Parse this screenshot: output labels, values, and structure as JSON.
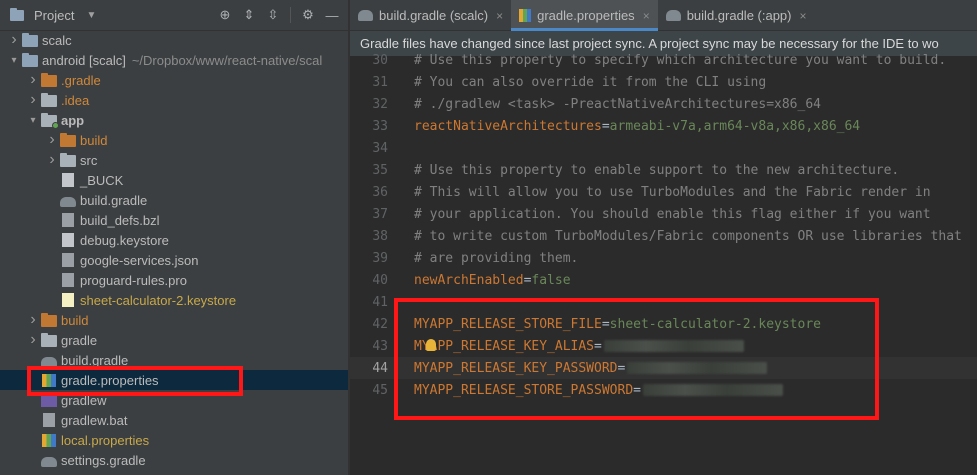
{
  "project_panel": {
    "title": "Project",
    "tree": [
      {
        "label": "scalc",
        "type": "folder-blue",
        "arrow": "right",
        "indent": 0
      },
      {
        "label": "android [scalc]",
        "path": "~/Dropbox/www/react-native/scal",
        "type": "folder-blue",
        "arrow": "down",
        "indent": 0
      },
      {
        "label": ".gradle",
        "type": "folder-orange",
        "arrow": "right",
        "indent": 1,
        "color": "orange"
      },
      {
        "label": ".idea",
        "type": "folder",
        "arrow": "right",
        "indent": 1,
        "color": "orange"
      },
      {
        "label": "app",
        "type": "folder-module",
        "arrow": "down",
        "indent": 1,
        "bold": true
      },
      {
        "label": "build",
        "type": "folder-orange",
        "arrow": "right",
        "indent": 2,
        "color": "orange"
      },
      {
        "label": "src",
        "type": "folder",
        "arrow": "right",
        "indent": 2
      },
      {
        "label": "_BUCK",
        "type": "file",
        "indent": 2
      },
      {
        "label": "build.gradle",
        "type": "gradle",
        "indent": 2
      },
      {
        "label": "build_defs.bzl",
        "type": "file-dark",
        "indent": 2
      },
      {
        "label": "debug.keystore",
        "type": "file",
        "indent": 2
      },
      {
        "label": "google-services.json",
        "type": "file-dark",
        "indent": 2
      },
      {
        "label": "proguard-rules.pro",
        "type": "file-dark",
        "indent": 2
      },
      {
        "label": "sheet-calculator-2.keystore",
        "type": "keystore",
        "indent": 2,
        "color": "yellow"
      },
      {
        "label": "build",
        "type": "folder-orange",
        "arrow": "right",
        "indent": 1,
        "color": "orange"
      },
      {
        "label": "gradle",
        "type": "folder",
        "arrow": "right",
        "indent": 1
      },
      {
        "label": "build.gradle",
        "type": "gradle",
        "indent": 1
      },
      {
        "label": "gradle.properties",
        "type": "props",
        "indent": 1,
        "selected": true
      },
      {
        "label": "gradlew",
        "type": "exe",
        "indent": 1
      },
      {
        "label": "gradlew.bat",
        "type": "file-dark",
        "indent": 1
      },
      {
        "label": "local.properties",
        "type": "props",
        "indent": 1,
        "color": "yellow"
      },
      {
        "label": "settings.gradle",
        "type": "gradle",
        "indent": 1
      }
    ]
  },
  "tabs": [
    {
      "label": "build.gradle (scalc)",
      "icon": "gradle-icon",
      "active": false
    },
    {
      "label": "gradle.properties",
      "icon": "properties-icon",
      "active": true
    },
    {
      "label": "build.gradle (:app)",
      "icon": "gradle-icon",
      "active": false
    }
  ],
  "notification": "Gradle files have changed since last project sync. A project sync may be necessary for the IDE to wo",
  "code_lines": [
    {
      "num": "30",
      "kind": "comment",
      "text": "# Use this property to specify which architecture you want to build."
    },
    {
      "num": "31",
      "kind": "comment",
      "text": "# You can also override it from the CLI using"
    },
    {
      "num": "32",
      "kind": "comment",
      "text": "# ./gradlew <task> -PreactNativeArchitectures=x86_64"
    },
    {
      "num": "33",
      "kind": "prop",
      "key": "reactNativeArchitectures",
      "value": "armeabi-v7a,arm64-v8a,x86,x86_64"
    },
    {
      "num": "34",
      "kind": "blank",
      "text": ""
    },
    {
      "num": "35",
      "kind": "comment",
      "text": "# Use this property to enable support to the new architecture."
    },
    {
      "num": "36",
      "kind": "comment",
      "text": "# This will allow you to use TurboModules and the Fabric render in"
    },
    {
      "num": "37",
      "kind": "comment",
      "text": "# your application. You should enable this flag either if you want"
    },
    {
      "num": "38",
      "kind": "comment",
      "text": "# to write custom TurboModules/Fabric components OR use libraries that"
    },
    {
      "num": "39",
      "kind": "comment",
      "text": "# are providing them."
    },
    {
      "num": "40",
      "kind": "prop",
      "key": "newArchEnabled",
      "value": "false"
    },
    {
      "num": "41",
      "kind": "blank",
      "text": ""
    },
    {
      "num": "42",
      "kind": "prop",
      "key": "MYAPP_RELEASE_STORE_FILE",
      "value": "sheet-calculator-2.keystore"
    },
    {
      "num": "43",
      "kind": "prop-blur",
      "key": "MYAPP_RELEASE_KEY_ALIAS",
      "bulb": true
    },
    {
      "num": "44",
      "kind": "prop-blur",
      "key": "MYAPP_RELEASE_KEY_PASSWORD",
      "current": true
    },
    {
      "num": "45",
      "kind": "prop-blur",
      "key": "MYAPP_RELEASE_STORE_PASSWORD"
    }
  ],
  "colors": {
    "accent": "#4a88c7",
    "highlight_box": "#ff1616",
    "comment": "#808080",
    "key": "#cc7832",
    "value": "#6a8759"
  }
}
